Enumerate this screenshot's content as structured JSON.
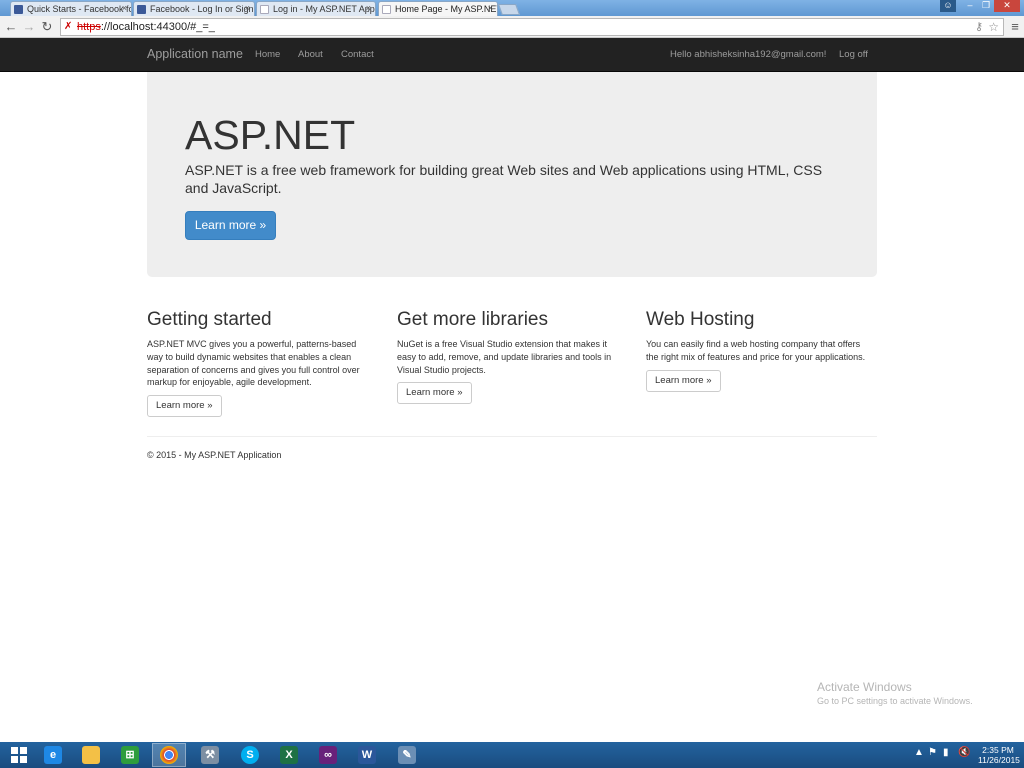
{
  "browser": {
    "tabs": [
      {
        "label": "Quick Starts - Facebook fo",
        "favicon": "facebook-icon"
      },
      {
        "label": "Facebook - Log In or Sign",
        "favicon": "facebook-icon"
      },
      {
        "label": "Log in - My ASP.NET Appli",
        "favicon": "page-icon"
      },
      {
        "label": "Home Page - My ASP.NET",
        "favicon": "page-icon",
        "active": true
      }
    ],
    "url_scheme": "https",
    "url_rest": "://localhost:44300/#_=_"
  },
  "site": {
    "brand": "Application name",
    "nav": [
      "Home",
      "About",
      "Contact"
    ],
    "user_greeting": "Hello abhisheksinha192@gmail.com!",
    "logoff": "Log off"
  },
  "jumbotron": {
    "title": "ASP.NET",
    "lead": "ASP.NET is a free web framework for building great Web sites and Web applications using HTML, CSS and JavaScript.",
    "button": "Learn more »"
  },
  "columns": [
    {
      "title": "Getting started",
      "text": "ASP.NET MVC gives you a powerful, patterns-based way to build dynamic websites that enables a clean separation of concerns and gives you full control over markup for enjoyable, agile development.",
      "button": "Learn more »"
    },
    {
      "title": "Get more libraries",
      "text": "NuGet is a free Visual Studio extension that makes it easy to add, remove, and update libraries and tools in Visual Studio projects.",
      "button": "Learn more »"
    },
    {
      "title": "Web Hosting",
      "text": "You can easily find a web hosting company that offers the right mix of features and price for your applications.",
      "button": "Learn more »"
    }
  ],
  "footer": "© 2015 - My ASP.NET Application",
  "watermark": {
    "line1": "Activate Windows",
    "line2": "Go to PC settings to activate Windows."
  },
  "taskbar": {
    "items": [
      "ie-icon",
      "explorer-icon",
      "store-icon",
      "chrome-icon",
      "tools-icon",
      "skype-icon",
      "excel-icon",
      "visual-studio-icon",
      "word-icon",
      "paint-icon"
    ],
    "time": "2:35 PM",
    "date": "11/26/2015"
  },
  "colors": {
    "navbar": "#222222",
    "primary": "#428bca",
    "jumbotron": "#eeeeee",
    "taskbar": "#1b4f83"
  }
}
